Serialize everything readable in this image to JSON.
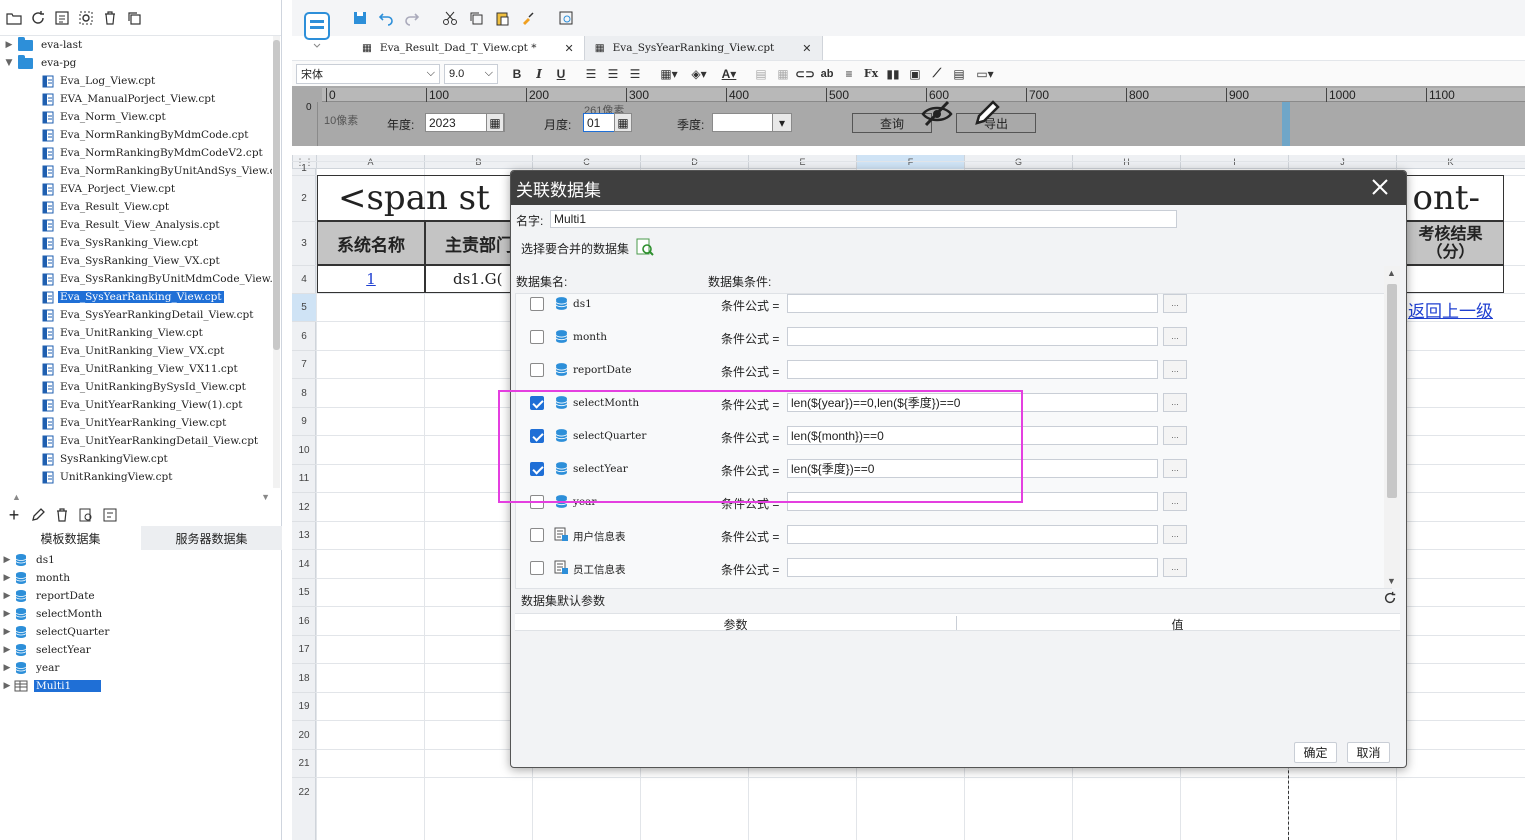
{
  "left_panel": {
    "tree": [
      {
        "label": "eva-last",
        "type": "folder",
        "expanded": false,
        "indent": 0
      },
      {
        "label": "eva-pg",
        "type": "folder",
        "expanded": true,
        "indent": 0
      },
      {
        "label": "Eva_Log_View.cpt",
        "type": "file",
        "indent": 1
      },
      {
        "label": "EVA_ManualPorject_View.cpt",
        "type": "file",
        "indent": 1
      },
      {
        "label": "Eva_Norm_View.cpt",
        "type": "file",
        "indent": 1
      },
      {
        "label": "Eva_NormRankingByMdmCode.cpt",
        "type": "file",
        "indent": 1
      },
      {
        "label": "Eva_NormRankingByMdmCodeV2.cpt",
        "type": "file",
        "indent": 1
      },
      {
        "label": "Eva_NormRankingByUnitAndSys_View.cpt",
        "type": "file",
        "indent": 1
      },
      {
        "label": "EVA_Porject_View.cpt",
        "type": "file",
        "indent": 1
      },
      {
        "label": "Eva_Result_View.cpt",
        "type": "file",
        "indent": 1
      },
      {
        "label": "Eva_Result_View_Analysis.cpt",
        "type": "file",
        "indent": 1
      },
      {
        "label": "Eva_SysRanking_View.cpt",
        "type": "file",
        "indent": 1
      },
      {
        "label": "Eva_SysRanking_View_VX.cpt",
        "type": "file",
        "indent": 1
      },
      {
        "label": "Eva_SysRankingByUnitMdmCode_View.cpt",
        "type": "file",
        "indent": 1
      },
      {
        "label": "Eva_SysYearRanking_View.cpt",
        "type": "file",
        "indent": 1,
        "selected": true
      },
      {
        "label": "Eva_SysYearRankingDetail_View.cpt",
        "type": "file",
        "indent": 1
      },
      {
        "label": "Eva_UnitRanking_View.cpt",
        "type": "file",
        "indent": 1
      },
      {
        "label": "Eva_UnitRanking_View_VX.cpt",
        "type": "file",
        "indent": 1
      },
      {
        "label": "Eva_UnitRanking_View_VX11.cpt",
        "type": "file",
        "indent": 1
      },
      {
        "label": "Eva_UnitRankingBySysId_View.cpt",
        "type": "file",
        "indent": 1
      },
      {
        "label": "Eva_UnitYearRanking_View(1).cpt",
        "type": "file",
        "indent": 1
      },
      {
        "label": "Eva_UnitYearRanking_View.cpt",
        "type": "file",
        "indent": 1
      },
      {
        "label": "Eva_UnitYearRankingDetail_View.cpt",
        "type": "file",
        "indent": 1
      },
      {
        "label": "SysRankingView.cpt",
        "type": "file",
        "indent": 1
      },
      {
        "label": "UnitRankingView.cpt",
        "type": "file",
        "indent": 1
      }
    ],
    "ds_tabs": [
      "模板数据集",
      "服务器数据集"
    ],
    "datasets": [
      {
        "label": "ds1",
        "icon": "database-icon"
      },
      {
        "label": "month",
        "icon": "database-icon"
      },
      {
        "label": "reportDate",
        "icon": "database-icon"
      },
      {
        "label": "selectMonth",
        "icon": "database-icon"
      },
      {
        "label": "selectQuarter",
        "icon": "database-icon"
      },
      {
        "label": "selectYear",
        "icon": "database-icon"
      },
      {
        "label": "year",
        "icon": "database-icon"
      },
      {
        "label": "Multi1",
        "icon": "table-icon",
        "selected": true
      }
    ]
  },
  "doc_tabs": [
    {
      "label": "Eva_Result_Dad_T_View.cpt *",
      "active": true
    },
    {
      "label": "Eva_SysYearRanking_View.cpt",
      "active": false
    }
  ],
  "format_bar": {
    "font_name": "宋体",
    "font_size": "9.0"
  },
  "param_panel": {
    "px_label": "10像素",
    "px_label2": "261像素",
    "year_label": "年度:",
    "year_value": "2023",
    "month_label": "月度:",
    "month_value": "01",
    "quarter_label": "季度:",
    "quarter_value": "",
    "query_button": "查询",
    "export_button": "导出",
    "ruler_ticks": [
      "0",
      "100",
      "200",
      "300",
      "400",
      "500",
      "600",
      "700",
      "800",
      "900",
      "1000",
      "1100"
    ],
    "vruler_label": "0"
  },
  "sheet": {
    "columns": [
      "A",
      "B",
      "C",
      "D",
      "E",
      "F",
      "G",
      "H",
      "I",
      "J",
      "K"
    ],
    "rows": [
      "1",
      "2",
      "3",
      "4",
      "5",
      "6",
      "7",
      "8",
      "9",
      "10",
      "11",
      "12",
      "13",
      "14",
      "15",
      "16",
      "17",
      "18",
      "19",
      "20",
      "21",
      "22"
    ],
    "title_left": "<span st",
    "title_right": "ont-",
    "header_a": "系统名称",
    "header_b": "主责部门",
    "header_k": "考核结果（分）",
    "cell_a3": "1",
    "cell_b3": "ds1.G(",
    "back_link": "返回上一级"
  },
  "dialog": {
    "title": "关联数据集",
    "name_label": "名字:",
    "name_value": "Multi1",
    "select_label": "选择要合并的数据集",
    "col_name_header": "数据集名:",
    "col_cond_header": "数据集条件:",
    "cond_label": "条件公式 =",
    "dot_label": "...",
    "rows": [
      {
        "name": "ds1",
        "checked": false,
        "formula": "",
        "icon": "database-icon"
      },
      {
        "name": "month",
        "checked": false,
        "formula": "",
        "icon": "database-icon"
      },
      {
        "name": "reportDate",
        "checked": false,
        "formula": "",
        "icon": "database-icon"
      },
      {
        "name": "selectMonth",
        "checked": true,
        "formula": "len(${year})==0,len(${季度})==0",
        "icon": "database-icon"
      },
      {
        "name": "selectQuarter",
        "checked": true,
        "formula": "len(${month})==0",
        "icon": "database-icon"
      },
      {
        "name": "selectYear",
        "checked": true,
        "formula": "len(${季度})==0",
        "icon": "database-icon"
      },
      {
        "name": "year",
        "checked": false,
        "formula": "",
        "icon": "database-icon"
      },
      {
        "name": "用户信息表",
        "checked": false,
        "formula": "",
        "icon": "server-table-icon"
      },
      {
        "name": "员工信息表",
        "checked": false,
        "formula": "",
        "icon": "server-table-icon"
      }
    ],
    "default_params_label": "数据集默认参数",
    "param_col": "参数",
    "value_col": "值",
    "ok_button": "确定",
    "cancel_button": "取消"
  },
  "colors": {
    "accent": "#1f6fd6",
    "highlight": "#e43fe0",
    "title_bar": "#3f3f3f"
  }
}
